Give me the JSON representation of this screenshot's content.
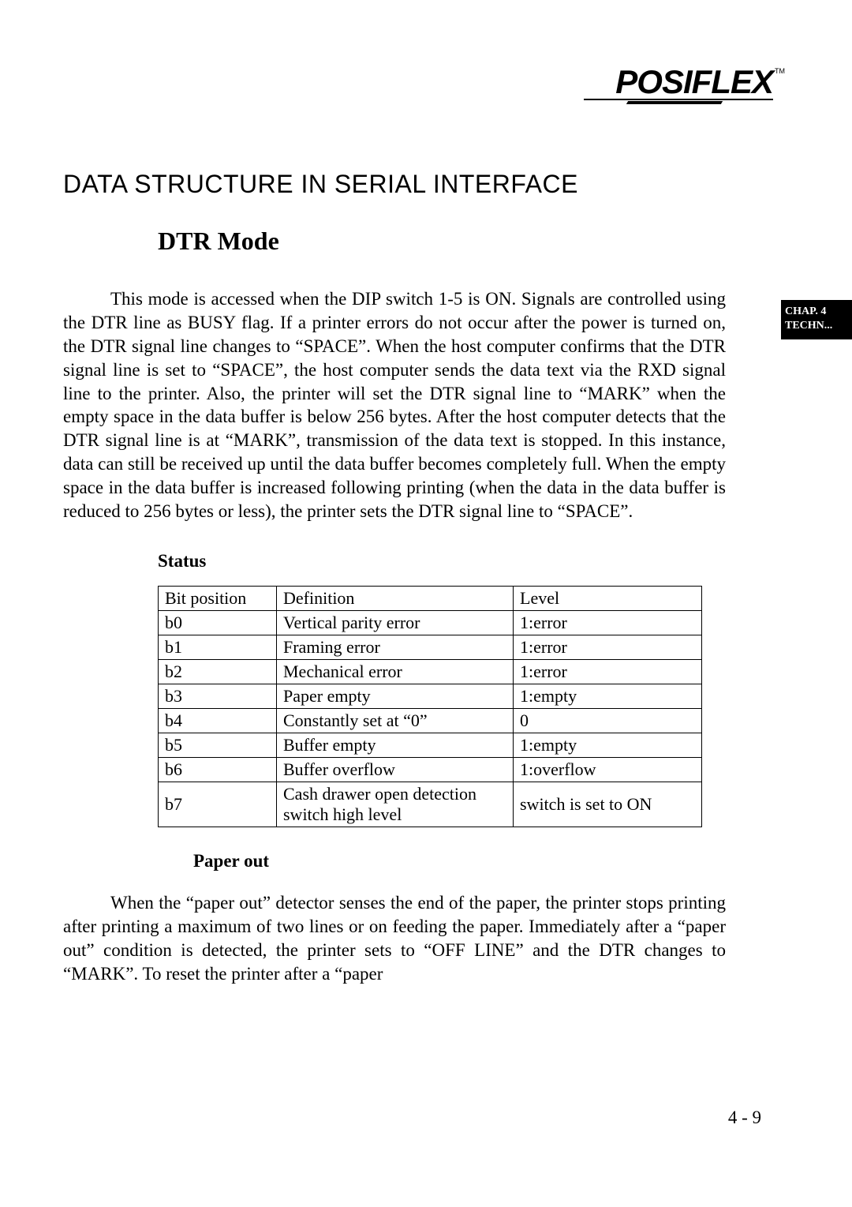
{
  "logo": {
    "text": "POSIFLEX",
    "tm": "TM"
  },
  "headings": {
    "main": "DATA STRUCTURE IN SERIAL INTERFACE",
    "sub": "DTR Mode",
    "status": "Status",
    "paper": "Paper out"
  },
  "paragraphs": {
    "dtr_mode": "This mode is accessed when the DIP switch 1-5 is ON. Signals are controlled using the DTR line as BUSY flag. If a printer errors do not occur after the power is turned on, the DTR signal line changes to “SPACE”. When the host computer confirms that the DTR signal line is set to “SPACE”, the host computer sends the data text via the RXD signal line to the printer. Also, the printer will set the DTR signal line to “MARK” when the empty space in the data buffer is below 256 bytes. After the host computer detects that the DTR signal line is at “MARK”, transmission of the data text is stopped. In this instance, data can still be received up until the data buffer becomes completely full. When the empty space in the data buffer is increased following printing (when the data in the data buffer is reduced to 256 bytes or less), the printer sets the DTR signal line to “SPACE”.",
    "paper_out": "When the “paper out” detector senses the end of the paper, the printer stops printing after printing a maximum of two lines or on feeding the paper. Immediately after a “paper out” condition is detected, the printer sets to “OFF LINE” and the DTR changes to “MARK”. To reset the printer after a “paper"
  },
  "table": {
    "headers": [
      "Bit position",
      "Definition",
      "Level"
    ],
    "rows": [
      [
        "b0",
        "Vertical parity error",
        "1:error"
      ],
      [
        "b1",
        "Framing error",
        "1:error"
      ],
      [
        "b2",
        "Mechanical error",
        "1:error"
      ],
      [
        "b3",
        "Paper empty",
        "1:empty"
      ],
      [
        "b4",
        "Constantly set at “0”",
        "0"
      ],
      [
        "b5",
        "Buffer empty",
        "1:empty"
      ],
      [
        "b6",
        "Buffer overflow",
        "1:overflow"
      ],
      [
        "b7",
        "Cash drawer open detection switch high level",
        "switch is set to ON"
      ]
    ]
  },
  "side_tab": {
    "line1": "CHAP. 4",
    "line2": "TECHN..."
  },
  "page_number": "4 - 9"
}
